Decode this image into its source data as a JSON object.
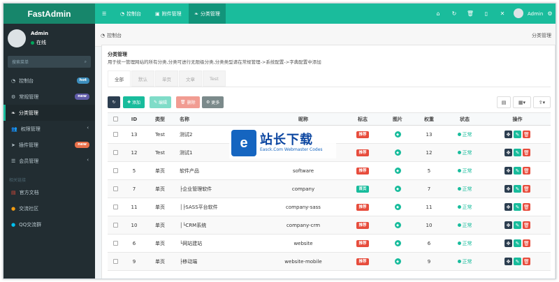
{
  "app": {
    "name": "FastAdmin"
  },
  "top_tabs": [
    {
      "label": "控制台",
      "icon": "dashboard-icon"
    },
    {
      "label": "附件管理",
      "icon": "image-icon"
    },
    {
      "label": "分类管理",
      "icon": "leaf-icon"
    }
  ],
  "top_icons": [
    "home-icon",
    "refresh-icon",
    "trash-icon",
    "fullscreen-icon",
    "expand-icon"
  ],
  "user": {
    "name": "Admin",
    "status": "在线"
  },
  "sidebar": {
    "search_placeholder": "搜索菜单",
    "items": [
      {
        "label": "控制台",
        "icon": "dashboard-icon",
        "badge": "hot",
        "badge_color": "#3c8dbc"
      },
      {
        "label": "常规管理",
        "icon": "cogs-icon",
        "badge": "new",
        "badge_color": "#605ca8"
      },
      {
        "label": "分类管理",
        "icon": "leaf-icon",
        "active": true
      },
      {
        "label": "权限管理",
        "icon": "group-icon",
        "chevron": true
      },
      {
        "label": "插件管理",
        "icon": "rocket-icon",
        "badge": "new",
        "badge_color": "#e8704a"
      },
      {
        "label": "会员管理",
        "icon": "list-icon",
        "chevron": true
      }
    ],
    "section_header": "相关链接",
    "links": [
      {
        "label": "官方文档",
        "icon": "book-icon",
        "color": "#dd4b39"
      },
      {
        "label": "交流社区",
        "icon": "comment-icon",
        "color": "#f39c12"
      },
      {
        "label": "QQ交流群",
        "icon": "qq-icon",
        "color": "#00c0ef"
      }
    ]
  },
  "breadcrumb": {
    "home": "控制台",
    "current": "分类管理"
  },
  "panel": {
    "title": "分类管理",
    "description": "用于统一管理网站的所有分类,分类可进行无限级分类,分类类型请在常规管理->系统配置->字典配置中添加",
    "tabs": [
      "全部",
      "默认",
      "单页",
      "文章",
      "Test"
    ]
  },
  "toolbar": {
    "refresh_icon": "refresh-icon",
    "add": "添加",
    "edit": "编辑",
    "delete": "删除",
    "more": "更多"
  },
  "table": {
    "headers": [
      "ID",
      "类型",
      "名称",
      "昵称",
      "标志",
      "图片",
      "权重",
      "状态",
      "操作"
    ],
    "rows": [
      {
        "id": "13",
        "type": "Test",
        "name": "测试2",
        "nickname": "",
        "flag": "推荐",
        "flag_color": "#e74c3c",
        "weight": "13",
        "status": "正常"
      },
      {
        "id": "12",
        "type": "Test",
        "name": "测试1",
        "nickname": "",
        "flag": "推荐",
        "flag_color": "#e74c3c",
        "weight": "12",
        "status": "正常"
      },
      {
        "id": "5",
        "type": "单页",
        "name": "软件产品",
        "nickname": "software",
        "flag": "推荐",
        "flag_color": "#e74c3c",
        "weight": "5",
        "status": "正常"
      },
      {
        "id": "7",
        "type": "单页",
        "name": "├企业管理软件",
        "nickname": "company",
        "flag": "首页",
        "flag_color": "#18bc9c",
        "weight": "7",
        "status": "正常"
      },
      {
        "id": "11",
        "type": "单页",
        "name": "│├SASS平台软件",
        "nickname": "company-sass",
        "flag": "推荐",
        "flag_color": "#e74c3c",
        "weight": "11",
        "status": "正常"
      },
      {
        "id": "10",
        "type": "单页",
        "name": "│└CRM系统",
        "nickname": "company-crm",
        "flag": "推荐",
        "flag_color": "#e74c3c",
        "weight": "10",
        "status": "正常"
      },
      {
        "id": "6",
        "type": "单页",
        "name": "└网站建站",
        "nickname": "website",
        "flag": "推荐",
        "flag_color": "#e74c3c",
        "weight": "6",
        "status": "正常"
      },
      {
        "id": "9",
        "type": "单页",
        "name": "├移动端",
        "nickname": "website-mobile",
        "flag": "推荐",
        "flag_color": "#e74c3c",
        "weight": "9",
        "status": "正常"
      }
    ]
  },
  "watermark": {
    "title": "站长下载",
    "subtitle": "Easck.Com Webmaster Codes"
  }
}
